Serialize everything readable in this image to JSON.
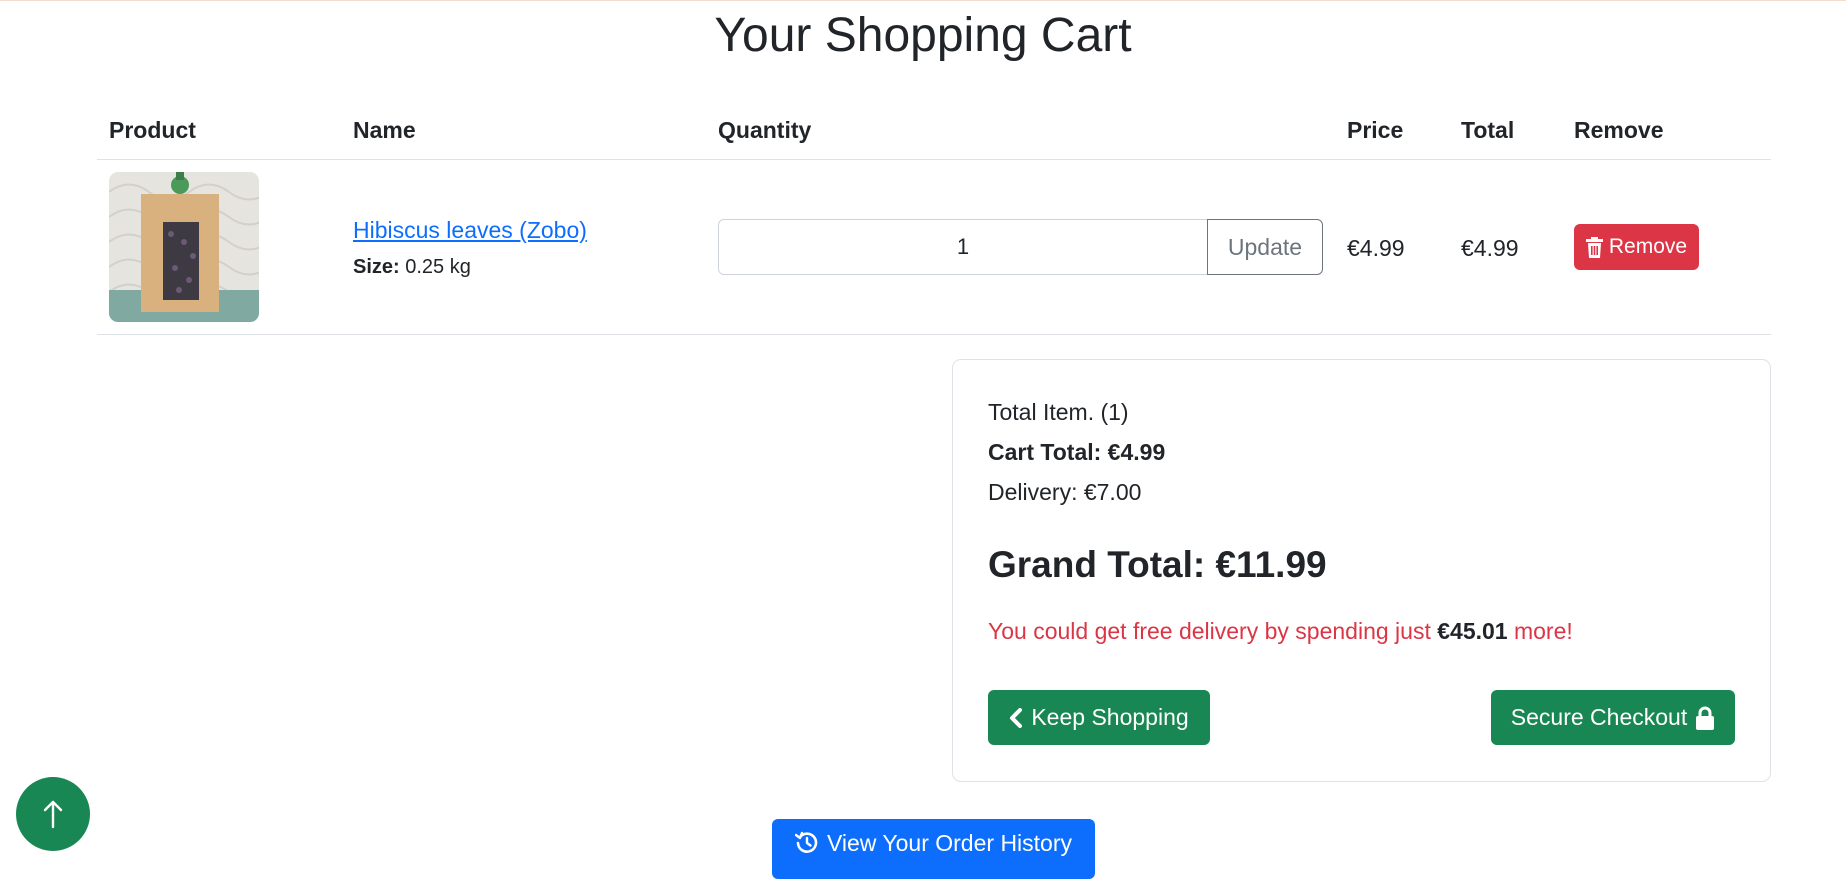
{
  "page": {
    "title": "Your Shopping Cart"
  },
  "table": {
    "headers": {
      "product": "Product",
      "name": "Name",
      "quantity": "Quantity",
      "price": "Price",
      "total": "Total",
      "remove": "Remove"
    },
    "rows": [
      {
        "name": "Hibiscus leaves (Zobo)",
        "size_label": "Size:",
        "size_value": "0.25 kg",
        "quantity": "1",
        "update_label": "Update",
        "price": "€4.99",
        "total": "€4.99",
        "remove_label": "Remove"
      }
    ]
  },
  "summary": {
    "total_items": "Total Item. (1)",
    "cart_total": "Cart Total: €4.99",
    "delivery": "Delivery: €7.00",
    "grand_total": "Grand Total: €11.99",
    "free_delivery_prefix": "You could get free delivery by spending just",
    "free_delivery_amount": "€45.01",
    "free_delivery_suffix": "more!",
    "keep_shopping_label": "Keep Shopping",
    "checkout_label": "Secure Checkout"
  },
  "footer": {
    "order_history_label": "View Your Order History"
  },
  "colors": {
    "danger": "#dc3545",
    "success": "#198754",
    "primary": "#0d6efd",
    "secondary": "#6c757d"
  },
  "icons": {
    "remove": "trash-icon",
    "keep_shopping": "chevron-left-icon",
    "checkout": "lock-icon",
    "order_history": "history-icon",
    "scroll_top": "arrow-up-icon"
  }
}
